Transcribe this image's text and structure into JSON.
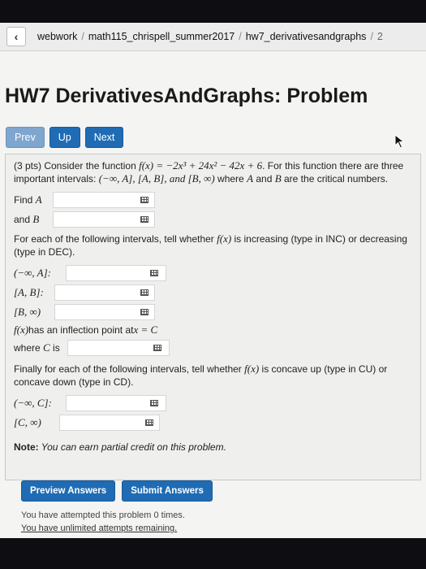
{
  "nav": {
    "back_icon": "chevron-left-icon",
    "breadcrumbs": [
      "webwork",
      "math115_chrispell_summer2017",
      "hw7_derivativesandgraphs",
      "2"
    ]
  },
  "page_title": "HW7 DerivativesAndGraphs: Problem",
  "buttons": {
    "prev": "Prev",
    "up": "Up",
    "next": "Next"
  },
  "problem": {
    "intro_prefix": "(3 pts) Consider the function ",
    "function": "f(x) = −2x³ + 24x² − 42x + 6",
    "intro_mid": ". For this function there are three important intervals: ",
    "intervals": "(−∞, A], [A, B], and [B, ∞)",
    "intro_mid2": " where ",
    "A": "A",
    "and_word": " and ",
    "B": "B",
    "intro_suffix": " are the critical numbers.",
    "find_label": "Find",
    "and_label": "and",
    "inc_prefix": "For each of the following intervals, tell whether ",
    "fx": "f(x)",
    "inc_suffix": " is increasing (type in INC) or decreasing (type in DEC).",
    "int1": "(−∞, A]:",
    "int2": "[A, B]:",
    "int3": "[B, ∞)",
    "infl_suffix": " has an inflection point at ",
    "infl_eq": "x = C",
    "where_label": "where",
    "C": "C",
    "is_label": "is",
    "conc_prefix": "Finally for each of the following intervals, tell whether ",
    "conc_suffix": " is concave up (type in CU) or concave down (type in CD).",
    "int4": "(−∞, C]:",
    "int5": "[C, ∞)",
    "note_label": "Note:",
    "note_text": " You can earn partial credit on this problem."
  },
  "actions": {
    "preview": "Preview Answers",
    "submit": "Submit Answers"
  },
  "status": {
    "attempts": "You have attempted this problem 0 times.",
    "remaining": "You have unlimited attempts remaining."
  },
  "colors": {
    "button_blue": "#1f6cb5",
    "prev_button": "#7ea6cf"
  }
}
